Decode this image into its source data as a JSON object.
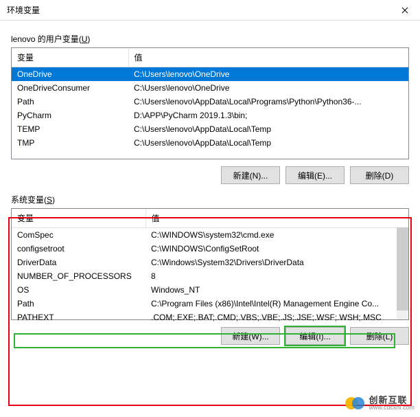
{
  "titlebar": {
    "title": "环境变量"
  },
  "user": {
    "section_label_prefix": "lenovo 的用户变量(",
    "section_label_hotkey": "U",
    "section_label_suffix": ")",
    "col_var": "变量",
    "col_val": "值",
    "rows": [
      {
        "var": "OneDrive",
        "val": "C:\\Users\\lenovo\\OneDrive",
        "selected": true
      },
      {
        "var": "OneDriveConsumer",
        "val": "C:\\Users\\lenovo\\OneDrive",
        "selected": false
      },
      {
        "var": "Path",
        "val": "C:\\Users\\lenovo\\AppData\\Local\\Programs\\Python\\Python36-...",
        "selected": false
      },
      {
        "var": "PyCharm",
        "val": "D:\\APP\\PyCharm 2019.1.3\\bin;",
        "selected": false
      },
      {
        "var": "TEMP",
        "val": "C:\\Users\\lenovo\\AppData\\Local\\Temp",
        "selected": false
      },
      {
        "var": "TMP",
        "val": "C:\\Users\\lenovo\\AppData\\Local\\Temp",
        "selected": false
      }
    ],
    "btn_new": "新建(N)...",
    "btn_edit": "编辑(E)...",
    "btn_delete": "删除(D)"
  },
  "system": {
    "section_label_prefix": "系统变量(",
    "section_label_hotkey": "S",
    "section_label_suffix": ")",
    "col_var": "变量",
    "col_val": "值",
    "rows": [
      {
        "var": "ComSpec",
        "val": "C:\\WINDOWS\\system32\\cmd.exe"
      },
      {
        "var": "configsetroot",
        "val": "C:\\WINDOWS\\ConfigSetRoot"
      },
      {
        "var": "DriverData",
        "val": "C:\\Windows\\System32\\Drivers\\DriverData"
      },
      {
        "var": "NUMBER_OF_PROCESSORS",
        "val": "8"
      },
      {
        "var": "OS",
        "val": "Windows_NT"
      },
      {
        "var": "Path",
        "val": "C:\\Program Files (x86)\\Intel\\Intel(R) Management Engine Co..."
      },
      {
        "var": "PATHEXT",
        "val": ".COM;.EXE;.BAT;.CMD;.VBS;.VBE;.JS;.JSE;.WSF;.WSH;.MSC"
      }
    ],
    "btn_new": "新建(W)...",
    "btn_edit": "编辑(I)...",
    "btn_delete": "删除(L)"
  },
  "watermark": {
    "cn": "创新互联",
    "url": "www.cdcxhl.com"
  }
}
